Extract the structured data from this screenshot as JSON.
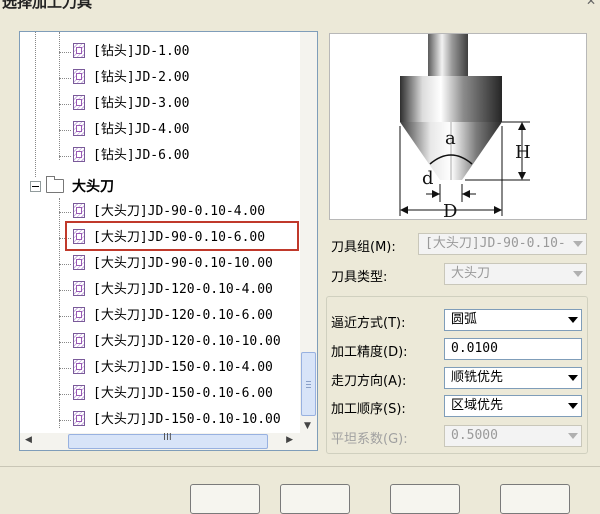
{
  "window": {
    "title": "选择加工刀具",
    "close_glyph": "✕"
  },
  "tree": {
    "drill_items": [
      "[钻头]JD-1.00",
      "[钻头]JD-2.00",
      "[钻头]JD-3.00",
      "[钻头]JD-4.00",
      "[钻头]JD-6.00"
    ],
    "folder_label": "大头刀",
    "big_head_items": [
      "[大头刀]JD-90-0.10-4.00",
      "[大头刀]JD-90-0.10-6.00",
      "[大头刀]JD-90-0.10-10.00",
      "[大头刀]JD-120-0.10-4.00",
      "[大头刀]JD-120-0.10-6.00",
      "[大头刀]JD-120-0.10-10.00",
      "[大头刀]JD-150-0.10-4.00",
      "[大头刀]JD-150-0.10-6.00",
      "[大头刀]JD-150-0.10-10.00"
    ],
    "selected_item": "[大头刀]JD-90-0.10-6.00",
    "hscroll_grip": "III"
  },
  "diagram": {
    "label_a": "a",
    "label_h": "H",
    "label_d_small": "d",
    "label_d_big": "D"
  },
  "tool_group": {
    "label": "刀具组(M):",
    "value": "[大头刀]JD-90-0.10-"
  },
  "tool_type": {
    "label": "刀具类型:",
    "value": "大头刀"
  },
  "approach": {
    "label": "逼近方式(T):",
    "value": "圆弧"
  },
  "precision": {
    "label": "加工精度(D):",
    "value": "0.0100"
  },
  "direction": {
    "label": "走刀方向(A):",
    "value": "顺铣优先"
  },
  "order": {
    "label": "加工顺序(S):",
    "value": "区域优先"
  },
  "flatness": {
    "label": "平坦系数(G):",
    "value": "0.5000"
  },
  "colors": {
    "selection_box": "#c0392b",
    "icon_purple": "#9b59b6",
    "dialog_bg": "#ece9d8"
  }
}
